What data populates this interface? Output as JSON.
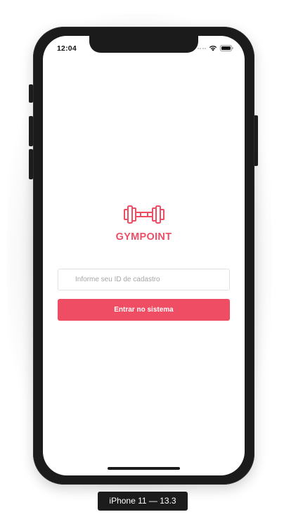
{
  "status_bar": {
    "time": "12:04"
  },
  "app": {
    "brand": "GYMPOINT",
    "logo_icon": "dumbbell-icon",
    "accent_color": "#ee4d64"
  },
  "login": {
    "id_input_placeholder": "Informe seu ID de cadastro",
    "id_input_value": "",
    "submit_label": "Entrar no sistema"
  },
  "simulator": {
    "device_label": "iPhone 11 — 13.3"
  }
}
